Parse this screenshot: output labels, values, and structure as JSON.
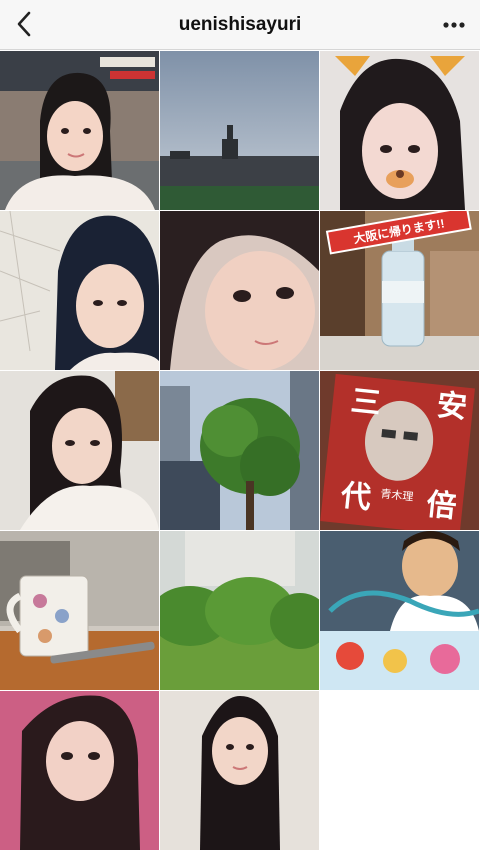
{
  "header": {
    "username": "uenishisayuri",
    "back_icon": "chevron-left-icon",
    "more_icon": "more-horizontal-icon"
  },
  "grid": {
    "posts": [
      {
        "id": 1,
        "description": "selfie at baseball stadium"
      },
      {
        "id": 2,
        "description": "baseball stadium under cloudy sky"
      },
      {
        "id": 3,
        "description": "selfie with cat face filter"
      },
      {
        "id": 4,
        "description": "selfie in front of map"
      },
      {
        "id": 5,
        "description": "close-up selfie"
      },
      {
        "id": 6,
        "description": "water bottle with sign"
      },
      {
        "id": 7,
        "description": "selfie in office"
      },
      {
        "id": 8,
        "description": "tree and building"
      },
      {
        "id": 9,
        "description": "book cover"
      },
      {
        "id": 10,
        "description": "mug on desk"
      },
      {
        "id": 11,
        "description": "green garden"
      },
      {
        "id": 12,
        "description": "manga illustration"
      },
      {
        "id": 13,
        "description": "selfie"
      },
      {
        "id": 14,
        "description": "portrait photo"
      }
    ],
    "sign_text": "大阪に帰ります!!",
    "book_title_chars": [
      "三",
      "安",
      "代",
      "倍"
    ],
    "book_author": "青木理"
  }
}
